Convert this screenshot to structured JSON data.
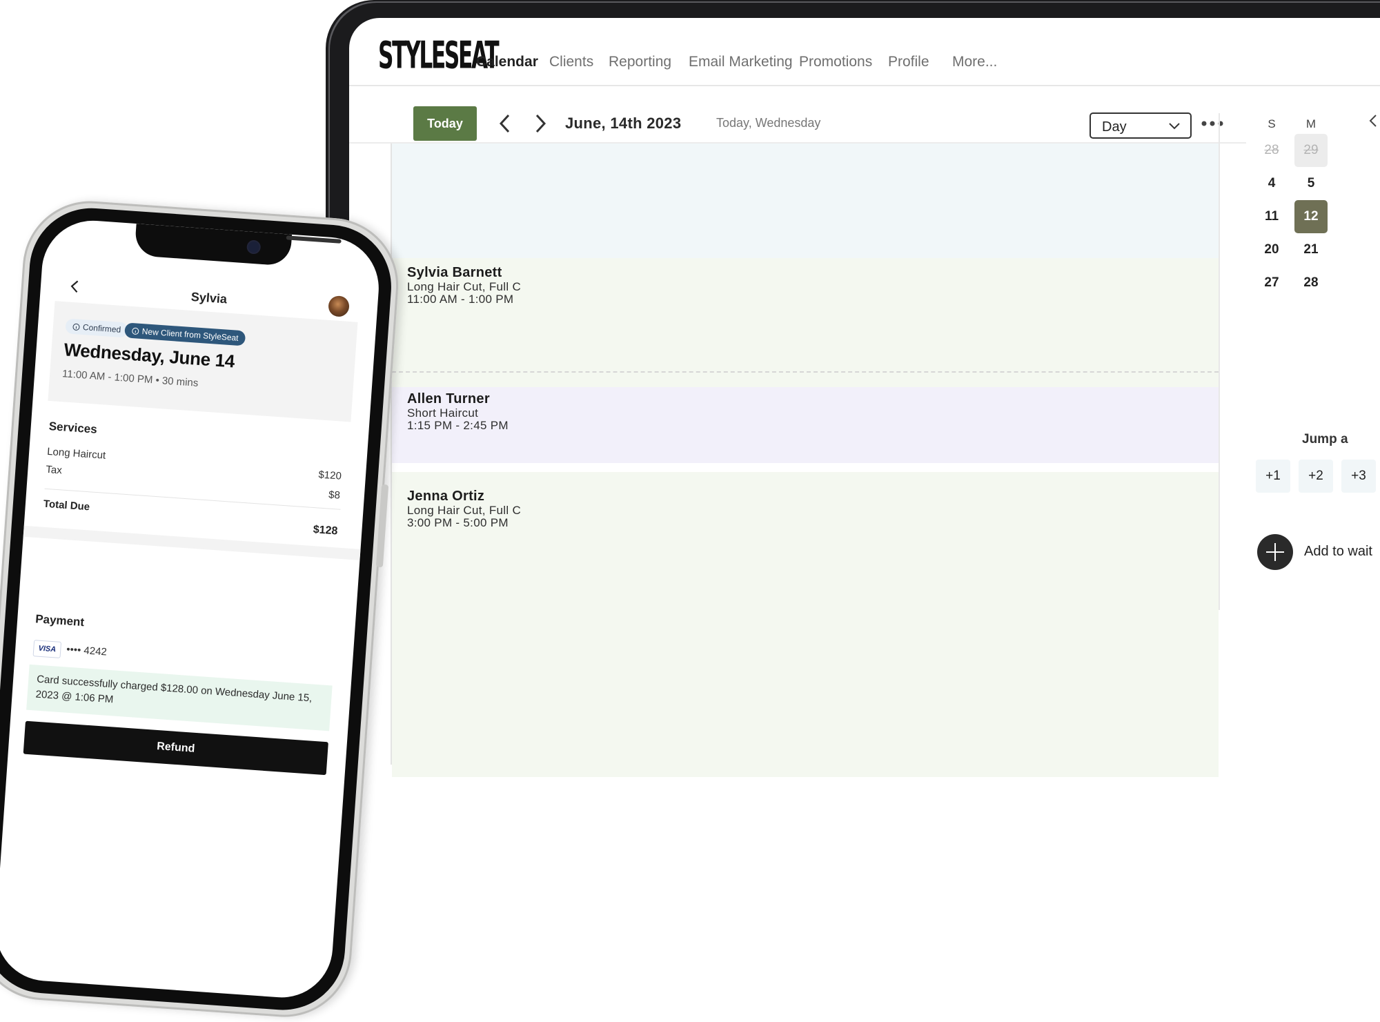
{
  "desktop": {
    "brand": "STYLESEAT",
    "nav": [
      {
        "label": "Calendar",
        "active": true
      },
      {
        "label": "Clients"
      },
      {
        "label": "Reporting"
      },
      {
        "label": "Email Marketing"
      },
      {
        "label": "Promotions"
      },
      {
        "label": "Profile"
      },
      {
        "label": "More..."
      }
    ],
    "toolbar": {
      "today_label": "Today",
      "date_title": "June, 14th 2023",
      "date_sub": "Today, Wednesday",
      "view_value": "Day"
    },
    "appointments": [
      {
        "name": "Sylvia Barnett",
        "service": "Long Hair Cut, Full C",
        "time": "11:00 AM - 1:00 PM",
        "color": "#f4f8f0"
      },
      {
        "name": "Allen Turner",
        "service": "Short Haircut",
        "time": "1:15 PM - 2:45 PM",
        "color": "#f2f0fa"
      },
      {
        "name": "Jenna Ortiz",
        "service": "Long Hair Cut, Full C",
        "time": "3:00 PM - 5:00 PM",
        "color": "#f4f8f0"
      }
    ],
    "mini_calendar": {
      "weekdays": [
        "S",
        "M"
      ],
      "rows": [
        [
          "28",
          "29"
        ],
        [
          "4",
          "5"
        ],
        [
          "11",
          "12"
        ],
        [
          "20",
          "21"
        ],
        [
          "27",
          "28"
        ]
      ],
      "selected": "12"
    },
    "jump_label": "Jump a",
    "jump_options": [
      "+1",
      "+2",
      "+3"
    ],
    "waitlist_label": "Add to wait"
  },
  "phone": {
    "client_name": "Sylvia",
    "badge_confirmed": "Confirmed",
    "badge_new": "New Client from StyleSeat",
    "date": "Wednesday, June 14",
    "time": "11:00 AM - 1:00 PM • 30 mins",
    "services_heading": "Services",
    "service_name": "Long Haircut",
    "service_price": "$120",
    "tax_label": "Tax",
    "tax_value": "$8",
    "total_label": "Total Due",
    "total_value": "$128",
    "payment_heading": "Payment",
    "card_brand": "VISA",
    "card_masked": "•••• 4242",
    "charge_message": "Card successfully charged $128.00 on Wednesday June 15, 2023 @ 1:06 PM",
    "refund_label": "Refund"
  },
  "colors": {
    "accent_green": "#5b7a45",
    "selected_day": "#6f7055",
    "badge_blue": "#2e577b",
    "slot_top": "#f1f7f9"
  }
}
